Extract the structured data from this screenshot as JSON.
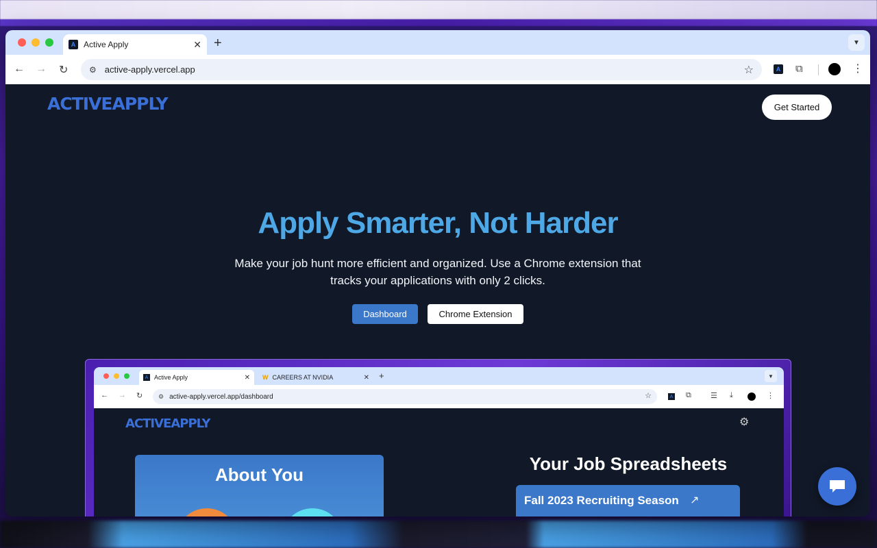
{
  "browser": {
    "tab_title": "Active Apply",
    "url": "active-apply.vercel.app"
  },
  "header": {
    "logo_text": "ACTIVEAPPLY",
    "cta_label": "Get Started"
  },
  "hero": {
    "title": "Apply Smarter, Not Harder",
    "subtitle": "Make your job hunt more efficient and organized. Use a Chrome extension that tracks your applications with only 2 clicks.",
    "primary_button": "Dashboard",
    "secondary_button": "Chrome Extension"
  },
  "preview": {
    "tab1_title": "Active Apply",
    "tab2_title": "CAREERS AT NVIDIA",
    "url": "active-apply.vercel.app/dashboard",
    "logo_text": "ACTIVEAPPLY",
    "about_title": "About You",
    "sheets_title": "Your Job Spreadsheets",
    "season_title": "Fall 2023 Recruiting Season"
  },
  "colors": {
    "accent": "#4ea8e6",
    "brand": "#3b6fd8",
    "page_bg": "#111827"
  }
}
